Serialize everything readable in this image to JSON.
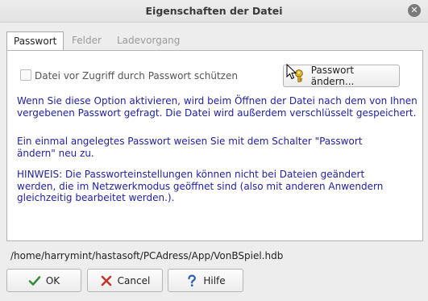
{
  "window": {
    "title": "Eigenschaften der Datei",
    "close_icon": "close-icon"
  },
  "tabs": [
    {
      "label": "Passwort",
      "active": true
    },
    {
      "label": "Felder",
      "active": false
    },
    {
      "label": "Ladevorgang",
      "active": false
    }
  ],
  "password_tab": {
    "checkbox_label": "Datei vor Zugriff durch Passwort schützen",
    "checkbox_checked": false,
    "change_password_label": "Passwort ändern...",
    "paragraph1": "Wenn Sie diese Option aktivieren, wird beim Öffnen der Datei nach dem von Ihnen\nvergebenen Passwort gefragt. Die Datei wird außerdem verschlüsselt gespeichert.",
    "paragraph2": "Ein einmal angelegtes Passwort weisen Sie mit dem Schalter \"Passwort\nändern\" neu zu.",
    "paragraph3": "HINWEIS: Die Passworteinstellungen können nicht bei Dateien geändert\nwerden, die im Netzwerkmodus geöffnet sind (also mit anderen Anwendern\ngleichzeitig bearbeitet werden.)."
  },
  "file_path": "/home/harrymint/hastasoft/PCAdress/App/VonBSpiel.hdb",
  "buttons": {
    "ok": "OK",
    "cancel": "Cancel",
    "help": "Hilfe"
  },
  "colors": {
    "info_text": "#1f1fa0",
    "ok_icon": "#3a8a3a",
    "cancel_icon": "#c0392b",
    "help_icon": "#2a5db0",
    "key_icon": "#e0b020"
  }
}
